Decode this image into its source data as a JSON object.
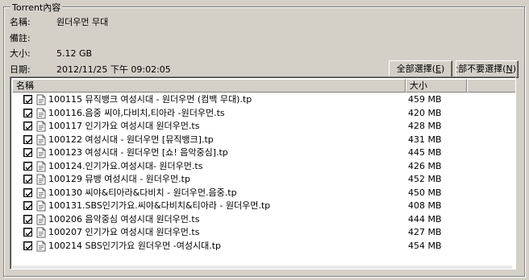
{
  "group": {
    "title": "Torrent內容"
  },
  "info": {
    "name_label": "名稱:",
    "name_value": "원더우먼 무대",
    "comment_label": "備註:",
    "comment_value": "",
    "size_label": "大小:",
    "size_value": "5.12 GB",
    "date_label": "日期:",
    "date_value": "2012/11/25 下午 09:02:05"
  },
  "buttons": {
    "select_all": "全部選擇(",
    "select_all_key": "E",
    "select_all_end": ")",
    "select_none": "全部不要選擇(",
    "select_none_key": "N",
    "select_none_end": ")"
  },
  "list": {
    "columns": {
      "name": "名稱",
      "size": "大小"
    },
    "rows": [
      {
        "checked": true,
        "name": "100115 뮤직뱅크 여성시대 - 원더우먼 (컴백 무대).tp",
        "size": "459 MB"
      },
      {
        "checked": true,
        "name": "100116.음중 씨야,다비치,티아라 -원더우먼.ts",
        "size": "420 MB"
      },
      {
        "checked": true,
        "name": "100117 인기가요 여성시대 원더우먼.ts",
        "size": "428 MB"
      },
      {
        "checked": true,
        "name": "100122 여성시대 - 원더우먼 [뮤직뱅크].tp",
        "size": "431 MB"
      },
      {
        "checked": true,
        "name": "100123 여성시대 - 원더우먼 [쇼! 음악중심].tp",
        "size": "445 MB"
      },
      {
        "checked": true,
        "name": "100124.인기가요.여성시대- 원더우먼.ts",
        "size": "426 MB"
      },
      {
        "checked": true,
        "name": "100129 뮤뱅 여성시대 - 원더우먼.tp",
        "size": "452 MB"
      },
      {
        "checked": true,
        "name": "100130 씨야&티아라&다비치 - 원더우먼.음중.tp",
        "size": "450 MB"
      },
      {
        "checked": true,
        "name": "100131.SBS인기가요.씨야&다비치&티아라 - 원더우먼.tp",
        "size": "408 MB"
      },
      {
        "checked": true,
        "name": "100206 음악중심 여성시대 원더우먼.ts",
        "size": "444 MB"
      },
      {
        "checked": true,
        "name": "100207 인기가요 여성시대 원더우먼.ts",
        "size": "427 MB"
      },
      {
        "checked": true,
        "name": "100214 SBS인기가요 원더우먼 -여성시대.tp",
        "size": "454 MB"
      }
    ]
  },
  "icons": {
    "checkbox": "checkmark-icon",
    "file": "file-icon"
  }
}
